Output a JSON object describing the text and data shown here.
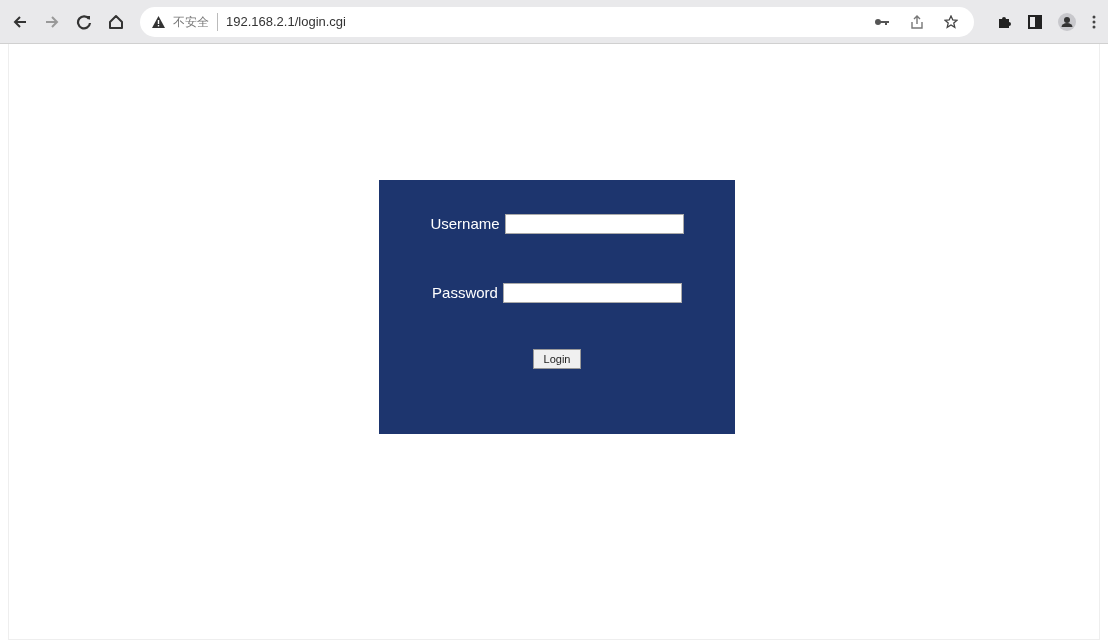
{
  "browser": {
    "security_label": "不安全",
    "url": "192.168.2.1/login.cgi"
  },
  "login_form": {
    "fields": [
      {
        "label": "Username"
      },
      {
        "label": "Password"
      }
    ],
    "button": "Login"
  }
}
